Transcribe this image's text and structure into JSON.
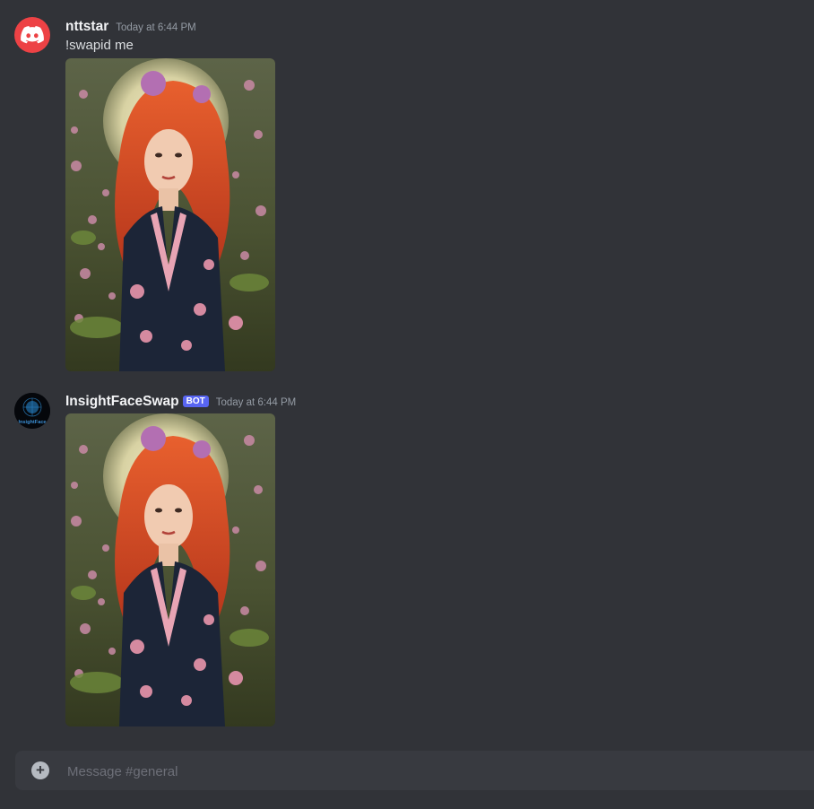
{
  "messages": [
    {
      "username": "nttstar",
      "timestamp": "Today at 6:44 PM",
      "text": "!swapid me",
      "avatar_icon": "discord-logo-icon",
      "attachment_image": "portrait of red-haired woman in floral kimono with pink flowers"
    },
    {
      "username": "InsightFaceSwap",
      "badge": "BOT",
      "timestamp": "Today at 6:44 PM",
      "avatar_text": "InsightFace",
      "attachment_image": "face-swapped portrait of red-haired woman in floral kimono with pink flowers"
    }
  ],
  "composer": {
    "placeholder": "Message #general",
    "add_icon": "plus-circle-icon"
  },
  "colors": {
    "background": "#313338",
    "composer": "#383a40",
    "bot_badge": "#5865f2",
    "discord_red": "#ed4245"
  }
}
